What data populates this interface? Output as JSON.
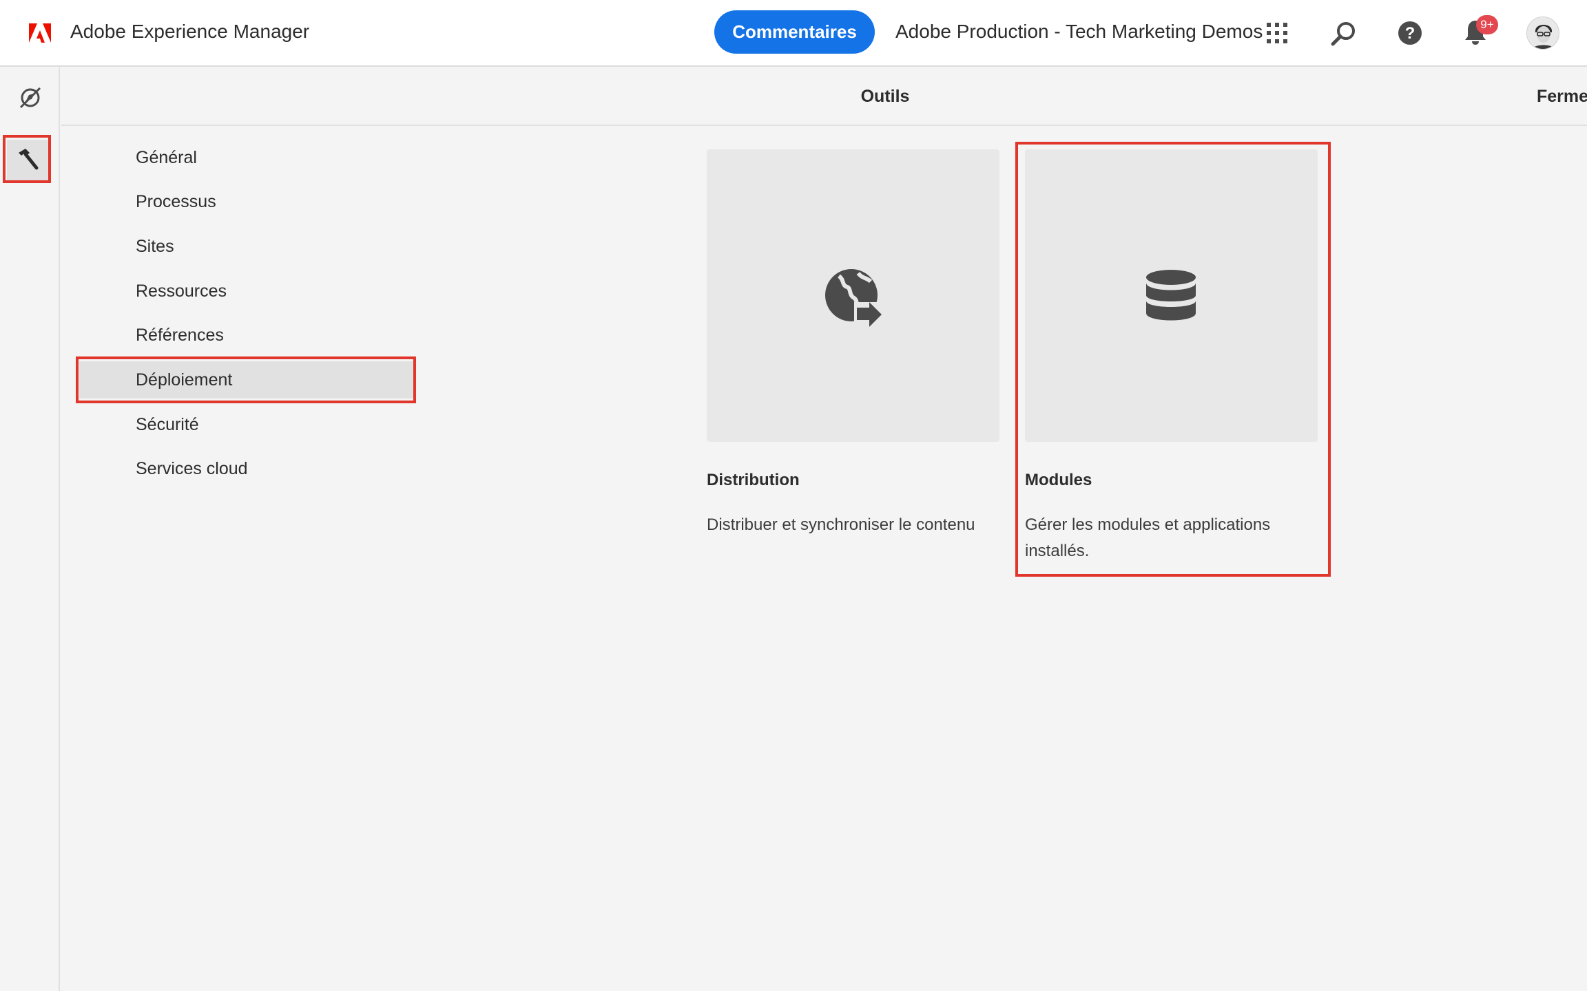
{
  "header": {
    "app_title": "Adobe Experience Manager",
    "feedback_label": "Commentaires",
    "org_name": "Adobe Production - Tech Marketing Demos",
    "notification_count": "9+"
  },
  "panel": {
    "title": "Outils",
    "close_label": "Fermer"
  },
  "categories": [
    {
      "label": "Général",
      "selected": false
    },
    {
      "label": "Processus",
      "selected": false
    },
    {
      "label": "Sites",
      "selected": false
    },
    {
      "label": "Ressources",
      "selected": false
    },
    {
      "label": "Références",
      "selected": false
    },
    {
      "label": "Déploiement",
      "selected": true
    },
    {
      "label": "Sécurité",
      "selected": false
    },
    {
      "label": "Services cloud",
      "selected": false
    }
  ],
  "cards": [
    {
      "title": "Distribution",
      "description": "Distribuer et synchroniser le contenu",
      "icon": "globe-sync-icon"
    },
    {
      "title": "Modules",
      "description": "Gérer les modules et applications installés.",
      "icon": "database-icon"
    }
  ],
  "colors": {
    "accent": "#1473e6",
    "highlight": "#e0362c",
    "badge": "#e34850",
    "adobe_red": "#eb1000"
  }
}
